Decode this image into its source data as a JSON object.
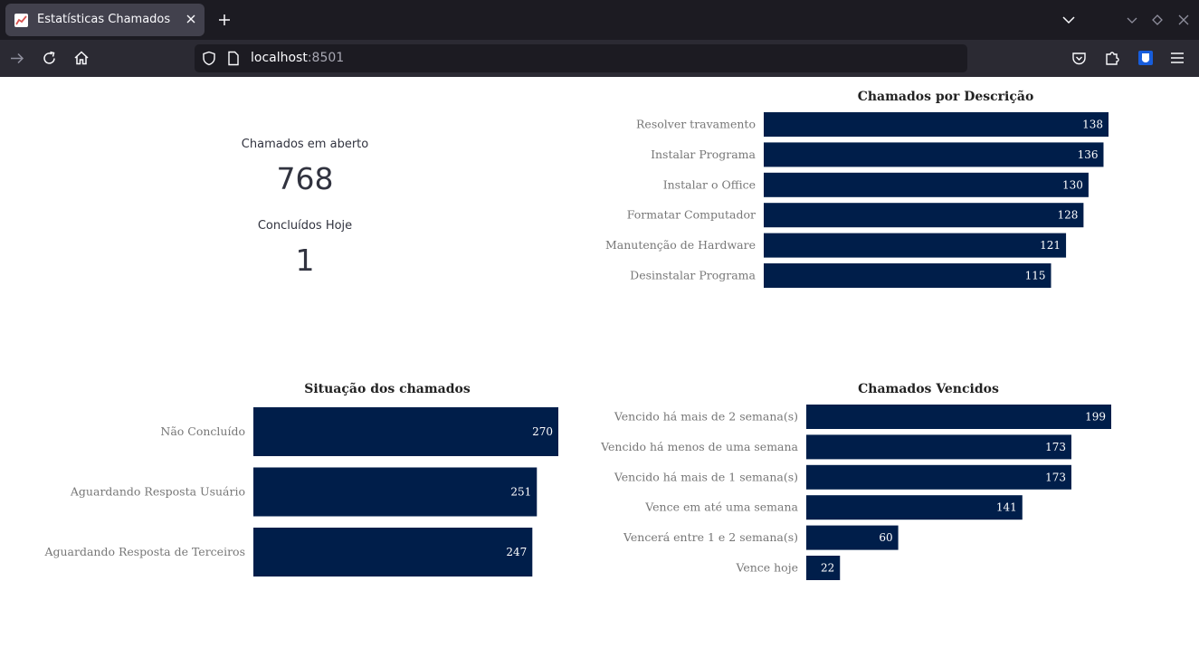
{
  "browser": {
    "tab_title": "Estatísticas Chamados",
    "url_host": "localhost",
    "url_port": ":8501"
  },
  "metrics": {
    "open_label": "Chamados em aberto",
    "open_value": "768",
    "done_label": "Concluídos Hoje",
    "done_value": "1"
  },
  "colors": {
    "bar": "#001e4a",
    "chrome_dark": "#1c1b22",
    "chrome_mid": "#2b2a33"
  },
  "chart_data": [
    {
      "id": "descricao",
      "type": "bar",
      "orientation": "horizontal",
      "title": "Chamados por Descrição",
      "categories": [
        "Resolver travamento",
        "Instalar Programa",
        "Instalar o Office",
        "Formatar Computador",
        "Manutenção de Hardware",
        "Desinstalar Programa"
      ],
      "values": [
        138,
        136,
        130,
        128,
        121,
        115
      ],
      "xlim": [
        0,
        138
      ]
    },
    {
      "id": "situacao",
      "type": "bar",
      "orientation": "horizontal",
      "title": "Situação dos chamados",
      "categories": [
        "Não Concluído",
        "Aguardando Resposta Usuário",
        "Aguardando Resposta de Terceiros"
      ],
      "values": [
        270,
        251,
        247
      ],
      "xlim": [
        0,
        270
      ]
    },
    {
      "id": "vencidos",
      "type": "bar",
      "orientation": "horizontal",
      "title": "Chamados Vencidos",
      "categories": [
        "Vencido há mais de 2 semana(s)",
        "Vencido há menos de uma semana",
        "Vencido há mais de 1 semana(s)",
        "Vence em até uma semana",
        "Vencerá entre 1 e 2 semana(s)",
        "Vence hoje"
      ],
      "values": [
        199,
        173,
        173,
        141,
        60,
        22
      ],
      "xlim": [
        0,
        199
      ]
    }
  ]
}
